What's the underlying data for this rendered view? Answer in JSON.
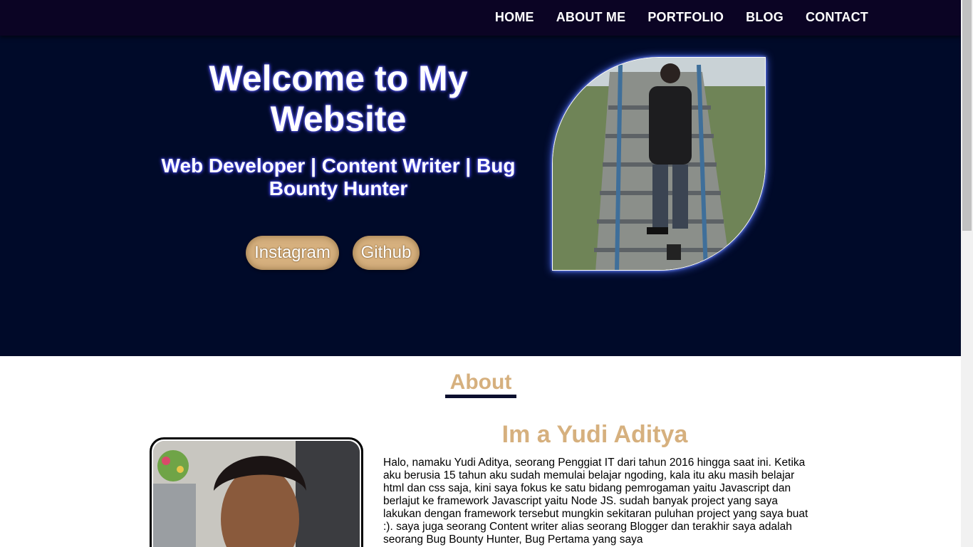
{
  "nav": {
    "items": [
      {
        "label": "HOME"
      },
      {
        "label": "ABOUT ME"
      },
      {
        "label": "PORTFOLIO"
      },
      {
        "label": "BLOG"
      },
      {
        "label": "CONTACT"
      }
    ]
  },
  "hero": {
    "title": "Welcome to My Website",
    "subtitle": "Web Developer | Content Writer | Bug Bounty Hunter",
    "buttons": {
      "instagram": "Instagram",
      "github": "Github"
    }
  },
  "about": {
    "heading": "About",
    "name": "Im a Yudi Aditya",
    "text": "Halo, namaku Yudi Aditya, seorang Penggiat IT dari tahun 2016 hingga saat ini. Ketika aku berusia 15 tahun aku sudah memulai belajar ngoding, kala itu aku masih belajar html dan css saja, kini saya fokus ke satu bidang pemrogaman yaitu Javascript dan berlajut ke framework Javascript yaitu Node JS. sudah banyak project yang saya lakukan dengan framework tersebut mungkin sekitaran puluhan project yang saya buat :). saya juga seorang Content writer alias seorang Blogger dan terakhir saya adalah seorang Bug Bounty Hunter, Bug Pertama yang saya"
  },
  "colors": {
    "navbar": "#0b0424",
    "hero_bg": "#000a29",
    "accent": "#d6b07e"
  }
}
